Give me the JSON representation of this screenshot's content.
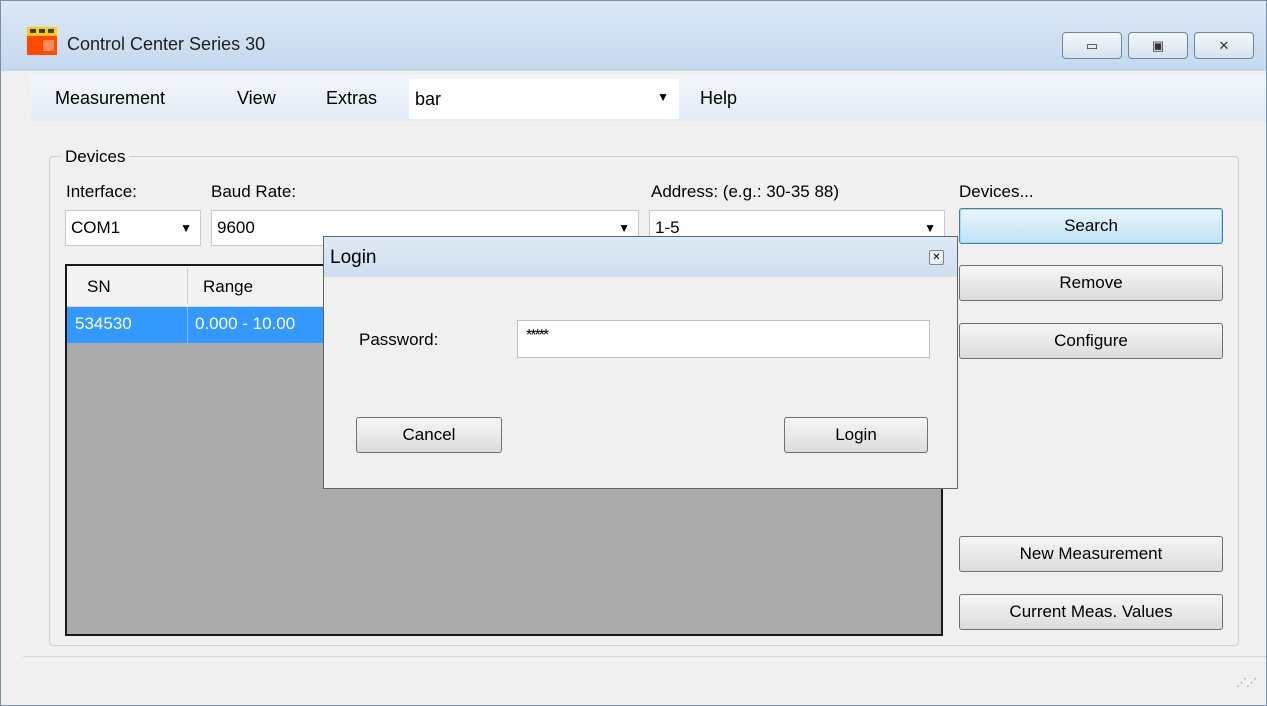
{
  "window": {
    "title": "Control Center Series 30"
  },
  "menu": {
    "items": [
      "Measurement",
      "View",
      "Extras"
    ],
    "combo_value": "bar",
    "help": "Help"
  },
  "devices": {
    "group_title": "Devices",
    "interface_label": "Interface:",
    "interface_value": "COM1",
    "baud_label": "Baud Rate:",
    "baud_value": "9600",
    "address_label": "Address: (e.g.: 30-35 88)",
    "address_value": "1-5",
    "devices_label": "Devices...",
    "table": {
      "columns": [
        "SN",
        "Range"
      ],
      "rows": [
        [
          "534530",
          "0.000 - 10.00"
        ]
      ]
    }
  },
  "buttons": {
    "search": "Search",
    "remove": "Remove",
    "configure": "Configure",
    "new_measurement": "New Measurement",
    "current_values": "Current Meas. Values"
  },
  "dialog": {
    "title": "Login",
    "password_label": "Password:",
    "password_value": "*****",
    "cancel": "Cancel",
    "login": "Login"
  },
  "colors": {
    "selection": "#3399ff",
    "grid_background": "#ababab",
    "titlebar": "#c5d8ee"
  }
}
